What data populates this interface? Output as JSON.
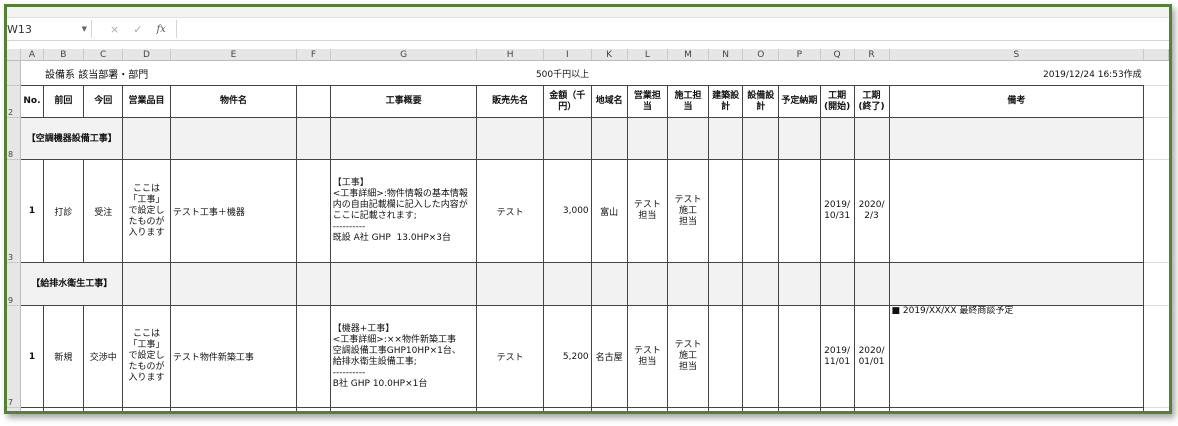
{
  "formula_bar": {
    "name_box": "W13",
    "cancel_icon": "×",
    "enter_icon": "✓",
    "fx_label": "fx",
    "formula": ""
  },
  "columns": [
    "A",
    "B",
    "C",
    "D",
    "E",
    "F",
    "G",
    "H",
    "I",
    "K",
    "L",
    "M",
    "N",
    "O",
    "P",
    "Q",
    "R",
    "S"
  ],
  "row_numbers": {
    "header": "2",
    "section1": "8",
    "data1": "3",
    "section2": "9",
    "data2": "7"
  },
  "title_row": {
    "title": "設備系 該当部署・部門",
    "threshold": "500千円以上",
    "created": "2019/12/24 16:53作成"
  },
  "headers": [
    "No.",
    "前回",
    "今回",
    "営業品目",
    "物件名",
    "",
    "工事概要",
    "販売先名",
    "金額（千円）",
    "地域名",
    "営業担当",
    "施工担当",
    "建築設計",
    "設備設計",
    "予定納期",
    "工期(開始)",
    "工期(終了)",
    "備考"
  ],
  "sections": [
    {
      "label": "【空調機器設備工事】",
      "rows": [
        {
          "no": "1",
          "prev": "打診",
          "curr": "受注",
          "item": "ここは「工事」で設定したものが入ります",
          "name": "テスト工事＋機器",
          "f": "",
          "summary": "【工事】\n<工事詳細>:物件情報の基本情報内の自由記載欄に記入した内容がここに記載されます;\n----------\n既設 A社 GHP  13.0HP×3台",
          "customer": "テスト",
          "amount": "3,000",
          "region": "富山",
          "sales": "テスト\n担当",
          "construction": "テスト\n施工\n担当",
          "arch": "",
          "equip": "",
          "due": "",
          "start": "2019/\n10/31",
          "end": "2020/\n2/3",
          "remarks": ""
        }
      ]
    },
    {
      "label": "【給排水衛生工事】",
      "rows": [
        {
          "no": "1",
          "prev": "新規",
          "curr": "交渉中",
          "item": "ここは「工事」で設定したものが入ります",
          "name": "テスト物件新築工事",
          "f": "",
          "summary": "【機器+工事】\n<工事詳細>:××物件新築工事\n空調設備工事GHP10HP×1台、\n給排水衛生設備工事;\n----------\nB社 GHP 10.0HP×1台",
          "customer": "テスト",
          "amount": "5,200",
          "region": "名古屋",
          "sales": "テスト\n担当",
          "construction": "テスト\n施工\n担当",
          "arch": "",
          "equip": "",
          "due": "",
          "start": "2019/\n11/01",
          "end": "2020/\n01/01",
          "remarks": "■ 2019/XX/XX 最終商談予定"
        }
      ]
    }
  ],
  "colors": {
    "frame": "#548235",
    "section_bg": "#f2f2f2",
    "header_bg": "#e6e6e6"
  }
}
